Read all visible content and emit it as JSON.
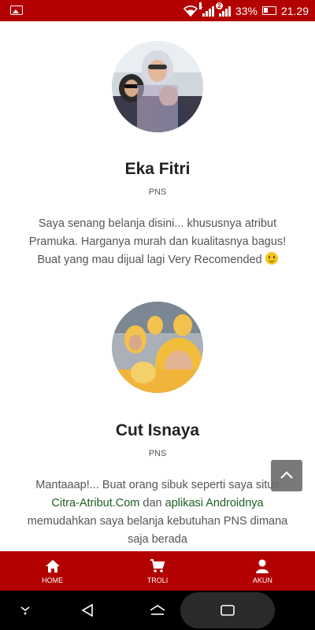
{
  "status_bar": {
    "battery": "33%",
    "time": "21.29",
    "sim1": "1",
    "sim2": "2"
  },
  "testimonials": [
    {
      "name": "Eka Fitri",
      "job": "PNS",
      "quote": "Saya senang belanja disini... khususnya atribut Pramuka. Harganya murah dan kualitasnya bagus! Buat yang mau dijual lagi Very Recomended"
    },
    {
      "name": "Cut Isnaya",
      "job": "PNS",
      "quote_part1": "Mantaaap!... Buat orang sibuk seperti  saya situs ",
      "quote_link1": "Citra-Atribut.Com",
      "quote_part2": " dan ",
      "quote_link2": "aplikasi Androidnya",
      "quote_part3": " memudahkan saya belanja kebutuhan PNS dimana saja berada"
    }
  ],
  "bottom_nav": {
    "items": [
      {
        "label": "HOME",
        "icon": "home-icon"
      },
      {
        "label": "TROLI",
        "icon": "cart-icon"
      },
      {
        "label": "AKUN",
        "icon": "user-icon"
      }
    ]
  },
  "colors": {
    "brand": "#b30000",
    "link": "#1f5f1f"
  }
}
